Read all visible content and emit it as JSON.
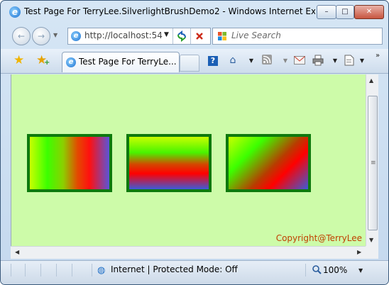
{
  "window": {
    "title": "Test Page For TerryLee.SilverlightBrushDemo2 - Windows Internet Ex...",
    "minimize_symbol": "–",
    "maximize_symbol": "□",
    "close_symbol": "✕"
  },
  "address_bar": {
    "url": "http://localhost:54",
    "back_symbol": "←",
    "forward_symbol": "→",
    "dropdown_symbol": "▼"
  },
  "search": {
    "placeholder": "Live Search"
  },
  "tab": {
    "label": "Test Page For TerryLe..."
  },
  "command_bar": {
    "help_symbol": "?",
    "more_symbol": "»"
  },
  "page": {
    "copyright": "Copyright@TerryLee",
    "background": "#cdfba9",
    "rect_border": "#0e7a0e",
    "gradient_colors": [
      "#c8ff00",
      "#3cff00",
      "#ff0000",
      "#3c5bd8"
    ]
  },
  "statusbar": {
    "zone": "Internet | Protected Mode: Off",
    "zoom": "100%"
  },
  "icons": {
    "app": "ie-logo-icon",
    "favorites": "star-icon",
    "add_favorites": "star-plus-icon",
    "home": "home-icon",
    "feeds": "rss-icon",
    "mail": "mail-icon",
    "print": "printer-icon",
    "page": "page-icon",
    "refresh": "refresh-icon",
    "stop": "stop-icon",
    "globe": "globe-icon",
    "zoom": "magnifier-icon"
  }
}
